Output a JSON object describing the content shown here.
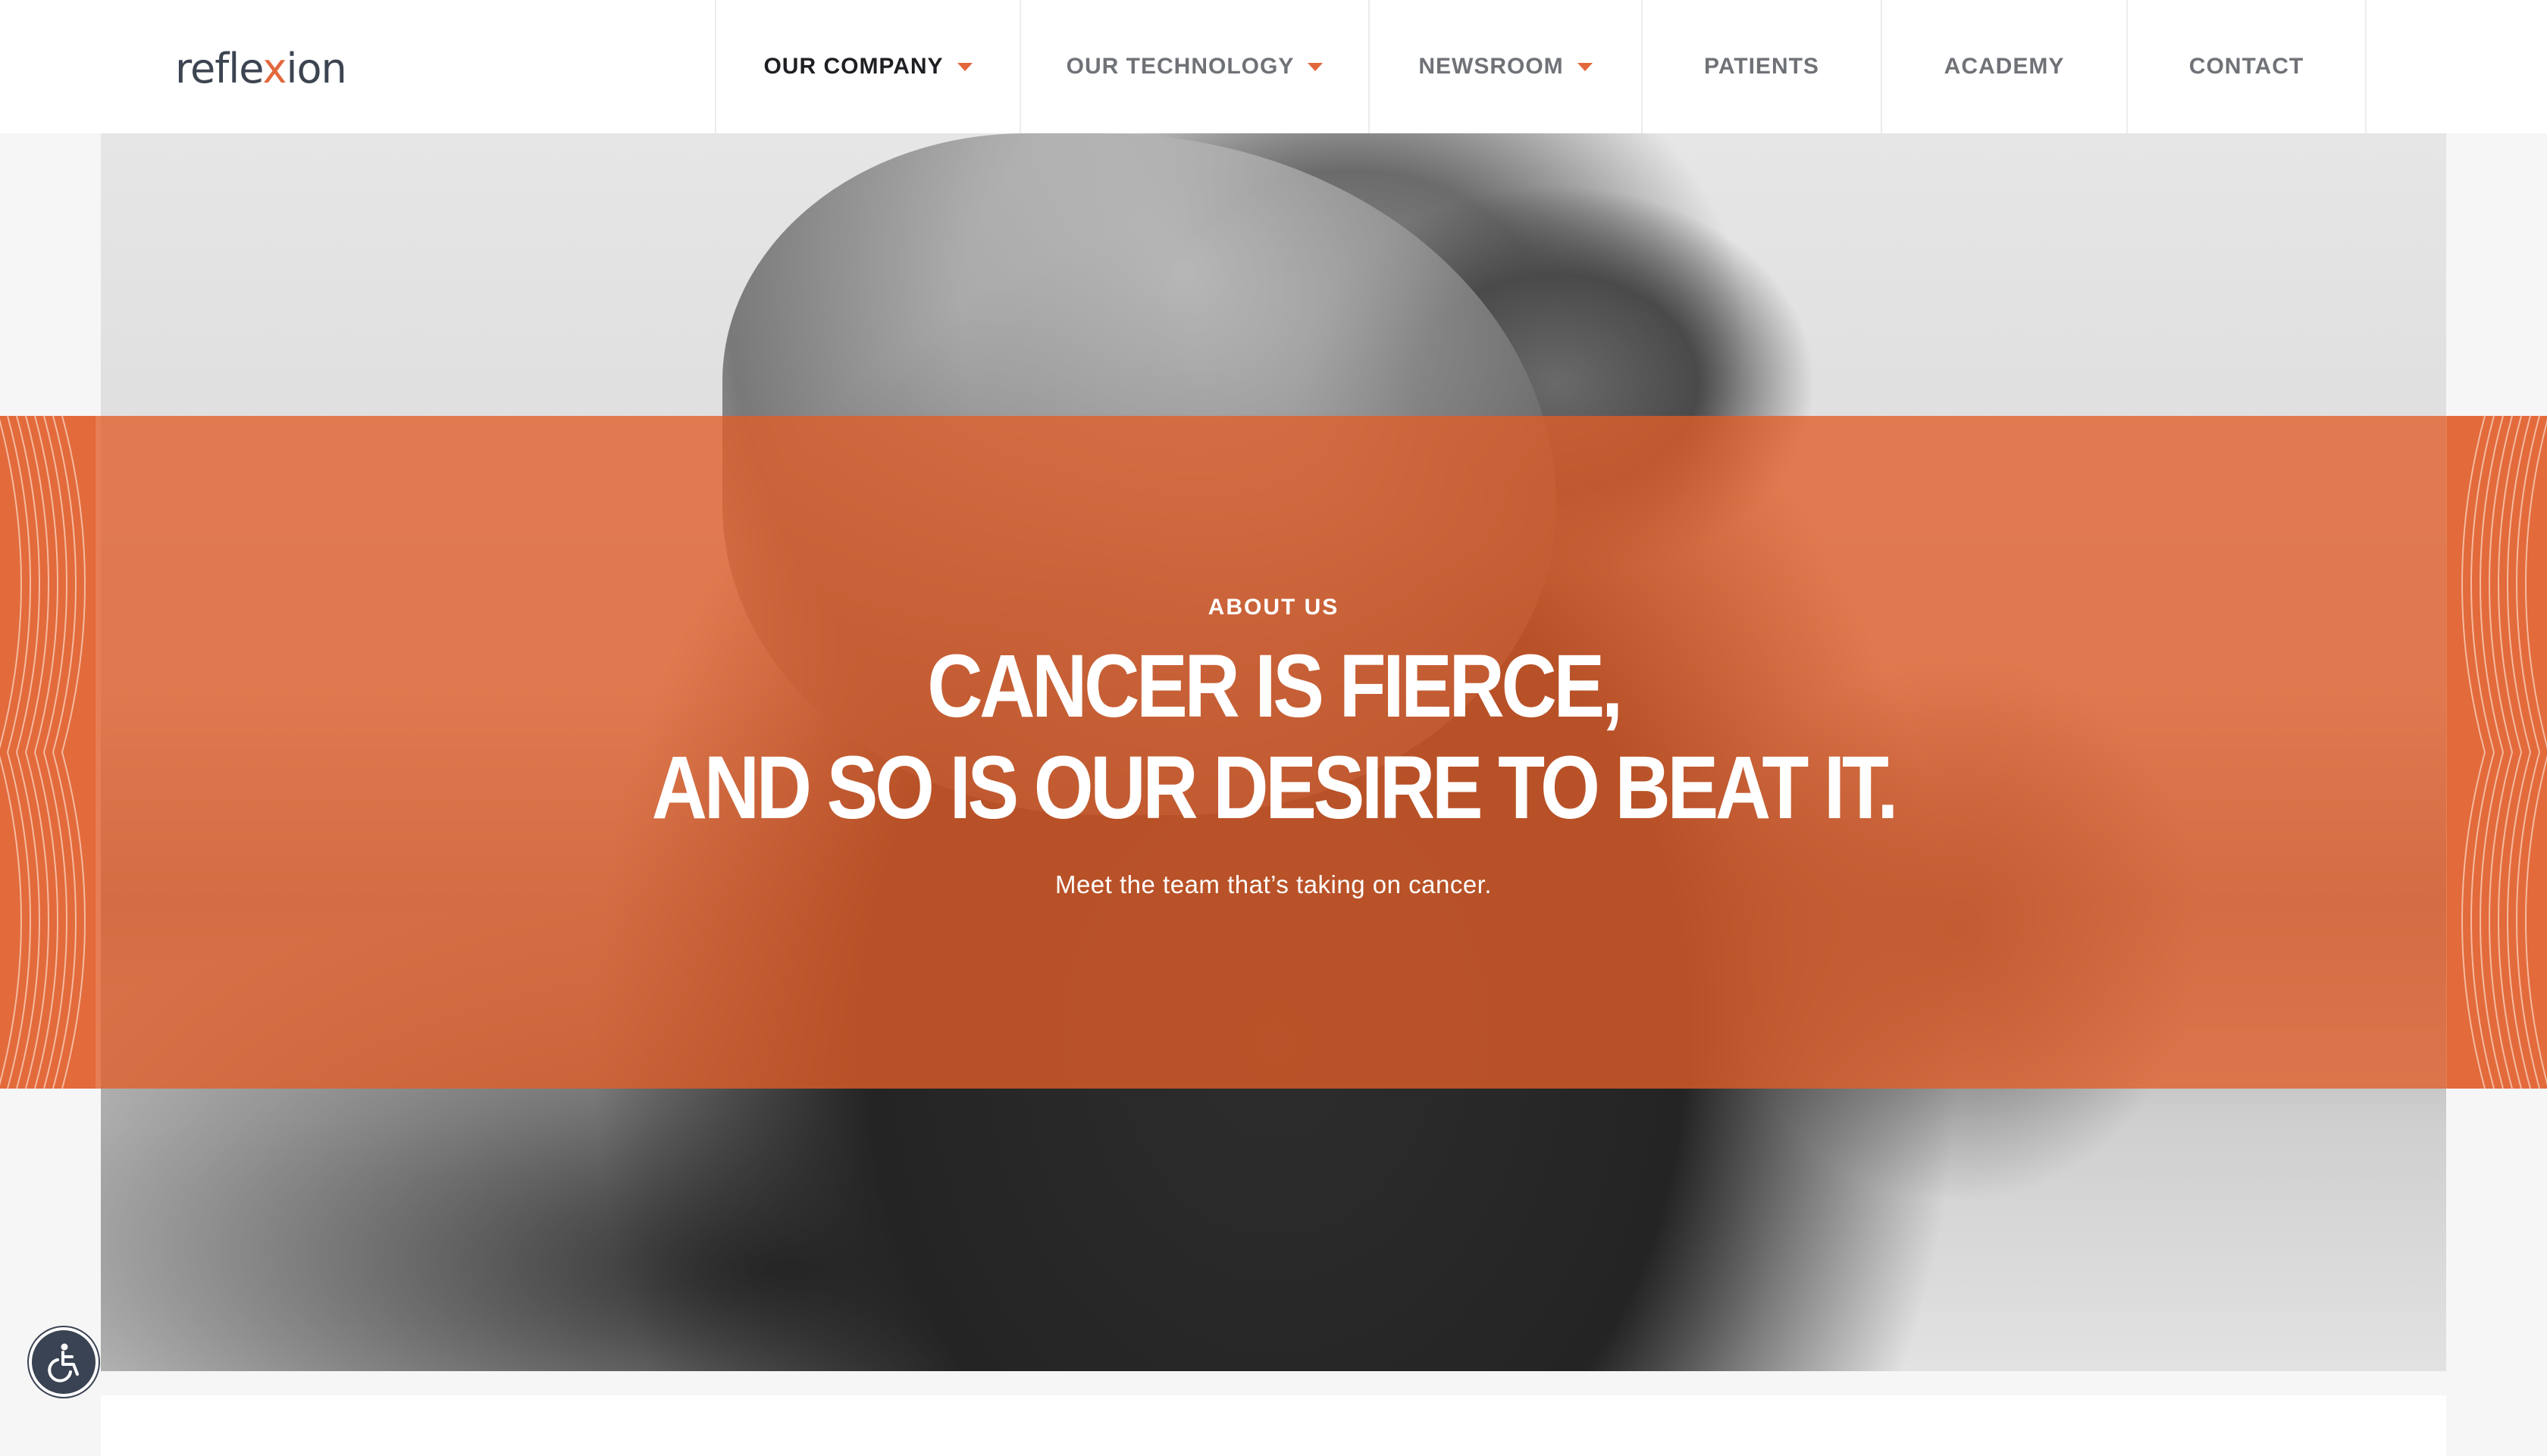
{
  "header": {
    "logo": {
      "prefix": "refle",
      "x": "x",
      "suffix": "ion"
    },
    "nav": [
      {
        "label": "OUR COMPANY",
        "has_dropdown": true,
        "active": true
      },
      {
        "label": "OUR TECHNOLOGY",
        "has_dropdown": true,
        "active": false
      },
      {
        "label": "NEWSROOM",
        "has_dropdown": true,
        "active": false
      },
      {
        "label": "PATIENTS",
        "has_dropdown": false,
        "active": false
      },
      {
        "label": "ACADEMY",
        "has_dropdown": false,
        "active": false
      },
      {
        "label": "CONTACT",
        "has_dropdown": false,
        "active": false
      }
    ]
  },
  "hero": {
    "eyebrow": "ABOUT US",
    "headline_line1": "CANCER IS FIERCE,",
    "headline_line2": "AND SO IS OUR DESIRE TO BEAT IT.",
    "subtext": "Meet the team that’s taking on cancer."
  },
  "accessibility": {
    "icon": "wheelchair-accessibility-icon"
  },
  "colors": {
    "accent": "#e2683b",
    "logo_text": "#3d4451",
    "nav_text": "#6f7277",
    "nav_active": "#1d1f22",
    "a11y_bg": "#3a4353"
  }
}
